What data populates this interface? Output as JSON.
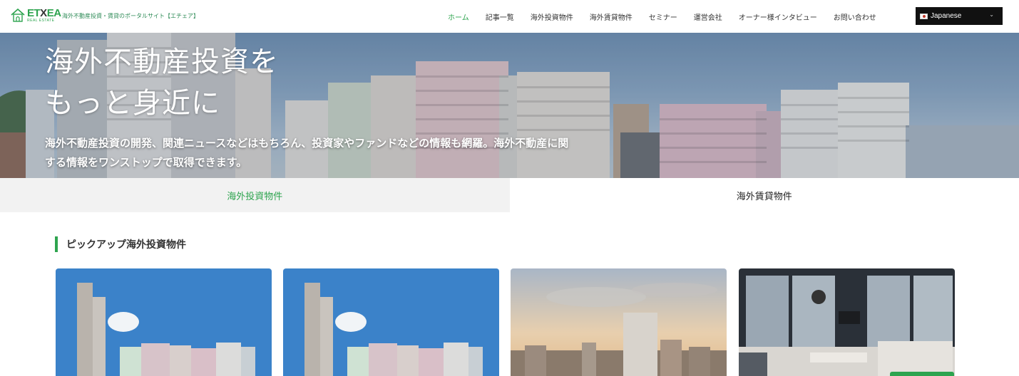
{
  "header": {
    "logo_text": "ETXEA",
    "logo_sub": "REAL ESTATE",
    "tagline": "海外不動産投資・賃貸のポータルサイト【エチェア】",
    "nav": [
      {
        "label": "ホーム",
        "active": true
      },
      {
        "label": "記事一覧",
        "active": false
      },
      {
        "label": "海外投資物件",
        "active": false
      },
      {
        "label": "海外賃貸物件",
        "active": false
      },
      {
        "label": "セミナー",
        "active": false
      },
      {
        "label": "運営会社",
        "active": false
      },
      {
        "label": "オーナー様インタビュー",
        "active": false
      },
      {
        "label": "お問い合わせ",
        "active": false
      }
    ],
    "language": "Japanese"
  },
  "hero": {
    "title_line1": "海外不動産投資を",
    "title_line2": "もっと身近に",
    "description": "海外不動産投資の開発、関連ニュースなどはもちろん、投資家やファンドなどの情報も網羅。海外不動産に関する情報をワンストップで取得できます。"
  },
  "tabs": [
    {
      "label": "海外投資物件",
      "active": true
    },
    {
      "label": "海外賃貸物件",
      "active": false
    }
  ],
  "section": {
    "title": "ピックアップ海外投資物件"
  },
  "cards": [
    {
      "image": "hong-kong-towers"
    },
    {
      "image": "hong-kong-towers"
    },
    {
      "image": "city-skyline-sunset"
    },
    {
      "image": "modern-interior"
    }
  ],
  "colors": {
    "accent": "#2ea44f",
    "lang_bg": "#111111",
    "tab_active_bg": "#f2f2f2"
  }
}
